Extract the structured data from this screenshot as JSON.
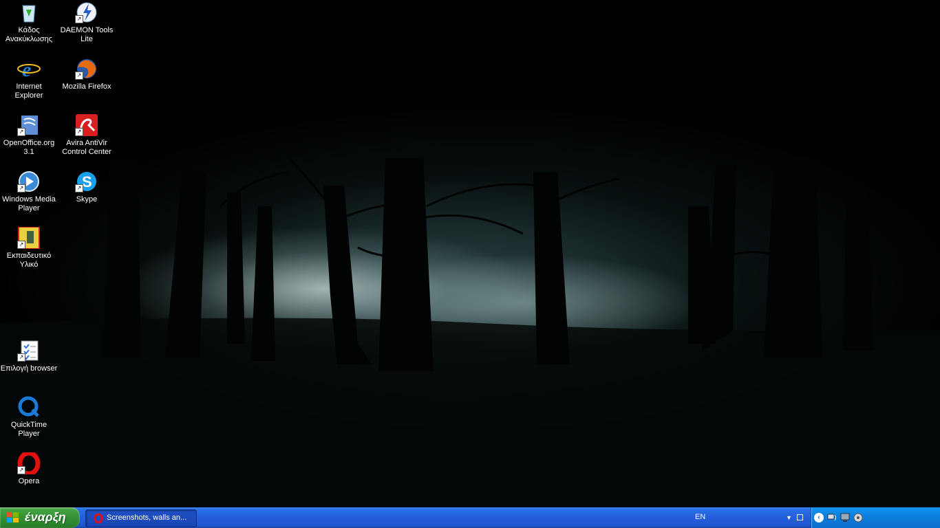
{
  "desktop": {
    "icons": [
      {
        "label_1": "Κάδος",
        "label_2": "Ανακύκλωσης",
        "icon": "recycle-bin-icon"
      },
      {
        "label_1": "DAEMON Tools",
        "label_2": "Lite",
        "icon": "daemon-tools-icon"
      },
      {
        "label_1": "Internet",
        "label_2": "Explorer",
        "icon": "internet-explorer-icon"
      },
      {
        "label_1": "Mozilla Firefox",
        "label_2": "",
        "icon": "firefox-icon"
      },
      {
        "label_1": "OpenOffice.org",
        "label_2": "3.1",
        "icon": "openoffice-icon"
      },
      {
        "label_1": "Avira AntiVir",
        "label_2": "Control Center",
        "icon": "avira-icon"
      },
      {
        "label_1": "Windows Media",
        "label_2": "Player",
        "icon": "windows-media-player-icon"
      },
      {
        "label_1": "Skype",
        "label_2": "",
        "icon": "skype-icon"
      },
      {
        "label_1": "Εκπαιδευτικό",
        "label_2": "Υλικό",
        "icon": "educational-material-icon"
      },
      {
        "label_1": "Επιλογή browser",
        "label_2": "",
        "icon": "browser-choice-icon"
      },
      {
        "label_1": "QuickTime Player",
        "label_2": "",
        "icon": "quicktime-icon"
      },
      {
        "label_1": "Opera",
        "label_2": "",
        "icon": "opera-icon"
      }
    ]
  },
  "taskbar": {
    "start_label": "έναρξη",
    "task_opera_label": "Screenshots, walls an...",
    "language": "EN",
    "colors": {
      "bar": "#245edb",
      "start": "#3b9a3b",
      "tray": "#0c7ddc"
    }
  }
}
